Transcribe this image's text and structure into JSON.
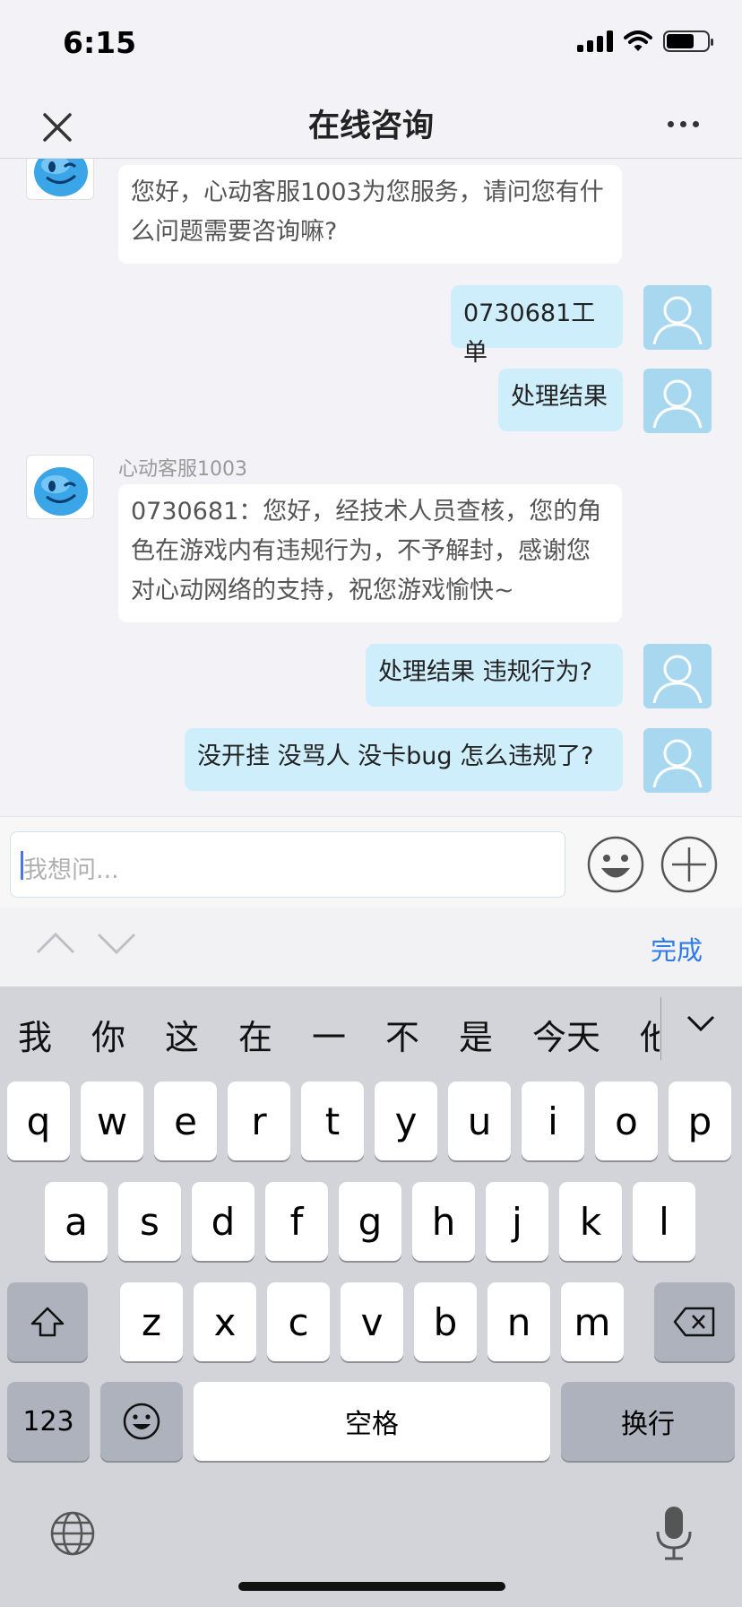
{
  "status": {
    "time": "6:15"
  },
  "nav": {
    "title": "在线咨询"
  },
  "messages": {
    "m1": {
      "text": "您好，心动客服1003为您服务，请问您有什么问题需要咨询嘛?"
    },
    "m2": {
      "text": "0730681工单"
    },
    "m3": {
      "text": "处理结果"
    },
    "m4": {
      "sender": "心动客服1003",
      "text": "0730681：您好，经技术人员查核，您的角色在游戏内有违规行为，不予解封，感谢您对心动网络的支持，祝您游戏愉快~"
    },
    "m5": {
      "text": "处理结果 违规行为?"
    },
    "m6": {
      "text": "没开挂 没骂人 没卡bug 怎么违规了?"
    }
  },
  "input": {
    "placeholder": "我想问..."
  },
  "keyboard": {
    "done_label": "完成",
    "candidates": [
      "我",
      "你",
      "这",
      "在",
      "一",
      "不",
      "是",
      "今天",
      "他"
    ],
    "row1": [
      "q",
      "w",
      "e",
      "r",
      "t",
      "y",
      "u",
      "i",
      "o",
      "p"
    ],
    "row2": [
      "a",
      "s",
      "d",
      "f",
      "g",
      "h",
      "j",
      "k",
      "l"
    ],
    "row3": [
      "z",
      "x",
      "c",
      "v",
      "b",
      "n",
      "m"
    ],
    "numbers_label": "123",
    "space_label": "空格",
    "return_label": "换行"
  },
  "colors": {
    "accent": "#2f7bea",
    "user_bubble": "#cfeefc",
    "user_avatar": "#a8d8f0"
  }
}
